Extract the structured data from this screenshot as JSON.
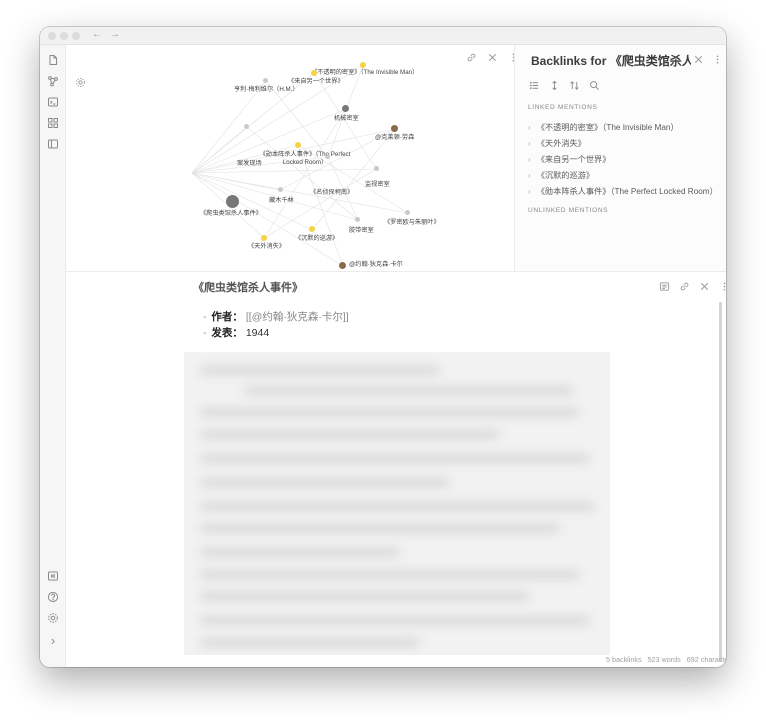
{
  "titlebar": {
    "back_glyph": "←",
    "forward_glyph": "→"
  },
  "ribbon": {
    "top_icons": [
      "file-icon",
      "graph-icon",
      "terminal-icon",
      "grid-icon",
      "layout-icon"
    ],
    "bottom_icons": [
      "vault-icon",
      "help-icon",
      "settings-icon"
    ],
    "expand_glyph": "›"
  },
  "graph": {
    "nodes": [
      {
        "name": "graph-node-invisible-room",
        "label": "《不透明的密室》（The Invisible Man）",
        "color": "#f5d442"
      },
      {
        "name": "graph-node-another-world",
        "label": "《来自另一个世界》",
        "color": "#f5d442"
      },
      {
        "name": "graph-node-hm",
        "label": "亨利·梅利维尔（H.M.）",
        "color": "#c9c9c9"
      },
      {
        "name": "graph-node-mechanical-room",
        "label": "机械密室",
        "color": "#777777"
      },
      {
        "name": "graph-node-clayton-rawson",
        "label": "@克莱顿·劳森",
        "color": "#8b6a4a"
      },
      {
        "name": "graph-node-perfect-locked-room",
        "label": "《勋本阵杀人事件》（The Perfect Locked Room）",
        "color": "#f5d442"
      },
      {
        "name": "graph-node-scene",
        "label": "案发现场",
        "color": "#c9c9c9"
      },
      {
        "name": "graph-node-detective-conan",
        "label": "《名侦探柯南》",
        "color": "#c9c9c9"
      },
      {
        "name": "graph-node-monitor-room",
        "label": "监视密室",
        "color": "#c9c9c9"
      },
      {
        "name": "graph-node-reptile-house",
        "label": "《爬虫类馆杀人事件》",
        "color": "#777777"
      },
      {
        "name": "graph-node-hagino",
        "label": "藏木千林",
        "color": "#c9c9c9"
      },
      {
        "name": "graph-node-romeo-juliet",
        "label": "《罗密欧与朱丽叶》",
        "color": "#c9c9c9"
      },
      {
        "name": "graph-node-prison-room",
        "label": "胶带密室",
        "color": "#c9c9c9"
      },
      {
        "name": "graph-node-silent-tour",
        "label": "《沉默的巡游》",
        "color": "#f5d442"
      },
      {
        "name": "graph-node-vanished",
        "label": "《天外消失》",
        "color": "#f5d442"
      },
      {
        "name": "graph-node-john-dickson-carr",
        "label": "@约翰·狄克森·卡尔",
        "color": "#8b6a4a"
      }
    ]
  },
  "backlinks": {
    "title": "Backlinks for 《爬虫类馆杀人事件》",
    "linked_heading": "LINKED MENTIONS",
    "unlinked_heading": "UNLINKED MENTIONS",
    "items": [
      "《不透明的密室》（The Invisible Man）",
      "《天外消失》",
      "《来自另一个世界》",
      "《沉默的巡游》",
      "《勋本阵杀人事件》（The Perfect Locked Room）"
    ]
  },
  "note": {
    "title": "《爬虫类馆杀人事件》",
    "props": [
      {
        "key": "作者：",
        "value": "[[@约翰·狄克森·卡尔]]",
        "is_link": true
      },
      {
        "key": "发表：",
        "value": "1944",
        "is_link": false
      }
    ]
  },
  "status": {
    "backlinks": "5 backlinks",
    "words": "523 words",
    "characters": "692 characters"
  }
}
